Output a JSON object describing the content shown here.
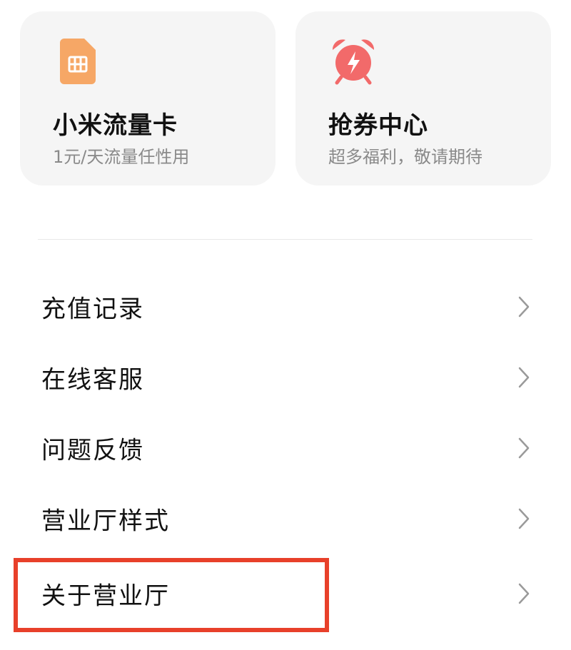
{
  "cards": [
    {
      "title": "小米流量卡",
      "subtitle": "1元/天流量任性用",
      "icon": "sim-card-icon",
      "color": "#f4a264"
    },
    {
      "title": "抢券中心",
      "subtitle": "超多福利，敬请期待",
      "icon": "alarm-clock-icon",
      "color": "#f05a5a"
    }
  ],
  "menu": [
    {
      "label": "充值记录"
    },
    {
      "label": "在线客服"
    },
    {
      "label": "问题反馈"
    },
    {
      "label": "营业厅样式"
    },
    {
      "label": "关于营业厅"
    }
  ],
  "highlight_color": "#e8402a"
}
